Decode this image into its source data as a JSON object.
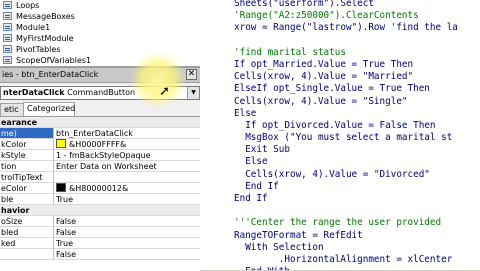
{
  "project_tree": {
    "items": [
      "Loops",
      "MessageBoxes",
      "Module1",
      "MyFirstModule",
      "PivotTables",
      "ScopeOfVariables1"
    ]
  },
  "properties": {
    "title": "ies - btn_EnterDataClick",
    "close": "✕",
    "object": "nterDataClick",
    "object_type": "CommandButton",
    "dropdown": "▼",
    "tabs": [
      "etic",
      "Categorized"
    ],
    "rows": [
      {
        "name": "earance",
        "value": "",
        "category": true
      },
      {
        "name": "me)",
        "value": "btn_EnterDataClick",
        "selected": true
      },
      {
        "name": "kColor",
        "value": "&H0000FFFF&",
        "color": "#ffff00"
      },
      {
        "name": "kStyle",
        "value": "1 - fmBackStyleOpaque"
      },
      {
        "name": "tion",
        "value": "Enter Data on Worksheet"
      },
      {
        "name": "trolTipText",
        "value": ""
      },
      {
        "name": "eColor",
        "value": "&H80000012&",
        "color": "#000000"
      },
      {
        "name": "ble",
        "value": "True"
      },
      {
        "name": "havior",
        "value": "",
        "category": true
      },
      {
        "name": "oSize",
        "value": "False"
      },
      {
        "name": "bled",
        "value": "False"
      },
      {
        "name": "ked",
        "value": "True"
      },
      {
        "name": "",
        "value": "False"
      }
    ]
  },
  "code": {
    "lines": [
      {
        "text": "Sheets(\"userform\").Select",
        "kind": "code"
      },
      {
        "text": "'Range(\"A2:z50000\").ClearContents",
        "kind": "comment"
      },
      {
        "text": "xrow = Range(\"lastrow\").Row 'find the la",
        "kind": "code"
      },
      {
        "text": "",
        "kind": "code"
      },
      {
        "text": "'find marital status",
        "kind": "comment"
      },
      {
        "text": "If opt_Married.Value = True Then",
        "kind": "code"
      },
      {
        "text": "Cells(xrow, 4).Value = \"Married\"",
        "kind": "code"
      },
      {
        "text": "ElseIf opt_Single.Value = True Then",
        "kind": "code"
      },
      {
        "text": "Cells(xrow, 4).Value = \"Single\"",
        "kind": "code"
      },
      {
        "text": "Else",
        "kind": "code"
      },
      {
        "text": "  If opt_Divorced.Value = False Then",
        "kind": "code"
      },
      {
        "text": "  MsgBox (\"You must select a marital st",
        "kind": "code"
      },
      {
        "text": "  Exit Sub",
        "kind": "code"
      },
      {
        "text": "  Else",
        "kind": "code"
      },
      {
        "text": "  Cells(xrow, 4).Value = \"Divorced\"",
        "kind": "code"
      },
      {
        "text": "  End If",
        "kind": "code"
      },
      {
        "text": "End If",
        "kind": "code"
      },
      {
        "text": "",
        "kind": "code"
      },
      {
        "text": "'''Center the range the user provided",
        "kind": "comment"
      },
      {
        "text": "RangeTOFormat = RefEdit",
        "kind": "code"
      },
      {
        "text": "  With Selection",
        "kind": "code"
      },
      {
        "text": "        .HorizontalAlignment = xlCenter",
        "kind": "code"
      },
      {
        "text": "  End With",
        "kind": "code"
      }
    ]
  }
}
